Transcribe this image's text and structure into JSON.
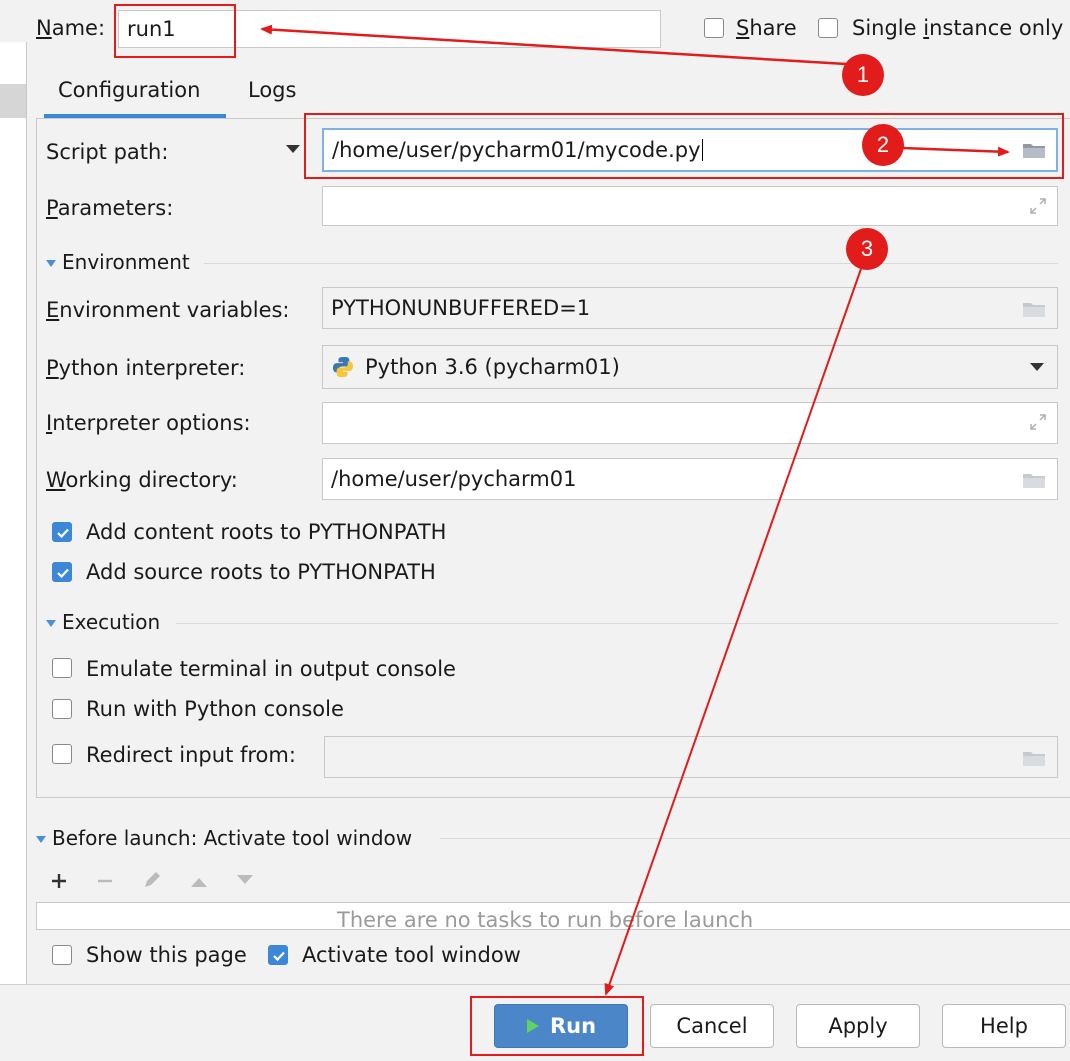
{
  "header": {
    "name_label": "Name:",
    "name_value": "run1",
    "share_label": "Share",
    "single_instance_label": "Single instance only"
  },
  "tabs": [
    {
      "label": "Configuration"
    },
    {
      "label": "Logs"
    }
  ],
  "form": {
    "script_path_label": "Script path:",
    "script_path_value": "/home/user/pycharm01/mycode.py",
    "parameters_label": "Parameters:",
    "parameters_value": "",
    "environment_section": "Environment",
    "env_vars_label": "Environment variables:",
    "env_vars_value": "PYTHONUNBUFFERED=1",
    "interpreter_label": "Python interpreter:",
    "interpreter_value": "Python 3.6 (pycharm01)",
    "interpreter_options_label": "Interpreter options:",
    "interpreter_options_value": "",
    "working_dir_label": "Working directory:",
    "working_dir_value": "/home/user/pycharm01",
    "add_content_roots_label": "Add content roots to PYTHONPATH",
    "add_content_roots_checked": true,
    "add_source_roots_label": "Add source roots to PYTHONPATH",
    "add_source_roots_checked": true,
    "execution_section": "Execution",
    "emulate_terminal_label": "Emulate terminal in output console",
    "run_with_console_label": "Run with Python console",
    "redirect_input_label": "Redirect input from:"
  },
  "before_launch": {
    "title": "Before launch: Activate tool window",
    "empty_text": "There are no tasks to run before launch",
    "show_page_label": "Show this page",
    "activate_tool_window_label": "Activate tool window"
  },
  "buttons": {
    "run": "Run",
    "cancel": "Cancel",
    "apply": "Apply",
    "help": "Help"
  },
  "annotations": [
    "1",
    "2",
    "3"
  ],
  "colors": {
    "accent": "#3d87d8",
    "annotation_red": "#e21b1b",
    "run_button": "#4a86c8"
  }
}
